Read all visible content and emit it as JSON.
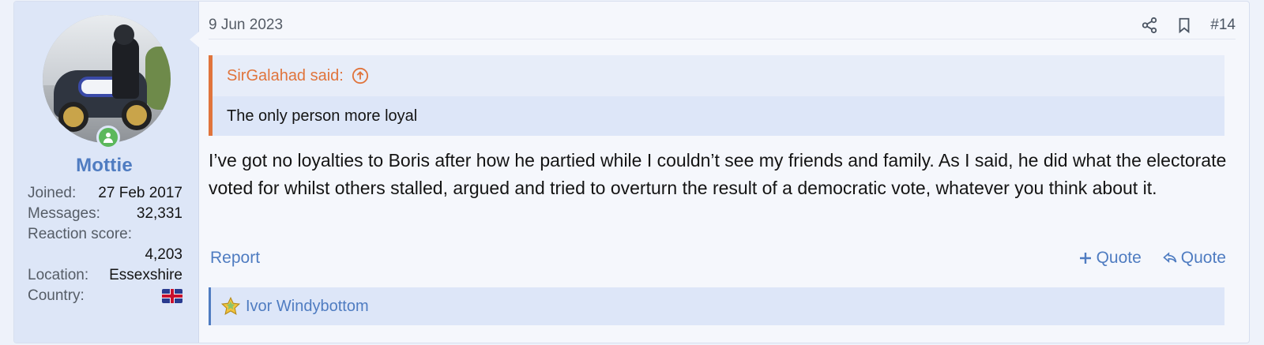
{
  "post": {
    "date": "9 Jun 2023",
    "number": "#14",
    "icons": {
      "share": "share-icon",
      "bookmark": "bookmark-icon"
    }
  },
  "user": {
    "name": "Mottie",
    "stats": {
      "joined_label": "Joined:",
      "joined_value": "27 Feb 2017",
      "messages_label": "Messages:",
      "messages_value": "32,331",
      "reaction_label": "Reaction score:",
      "reaction_value": "4,203",
      "location_label": "Location:",
      "location_value": "Essexshire",
      "country_label": "Country:"
    },
    "online": true
  },
  "quote": {
    "author": "SirGalahad said:",
    "text": "The only person more loyal"
  },
  "message": "I’ve got no loyalties to Boris after how he partied while I couldn’t see my friends and family. As I said, he did what the electorate voted for whilst others stalled, argued and tried to overturn the result of a democratic vote, whatever you think about it.",
  "actions": {
    "report": "Report",
    "multi_quote": "Quote",
    "reply_quote": "Quote"
  },
  "reactions": {
    "users": "Ivor Windybottom"
  },
  "colors": {
    "accent": "#4f7cc1",
    "quote_border": "#e0743c",
    "online": "#5cb85c"
  }
}
